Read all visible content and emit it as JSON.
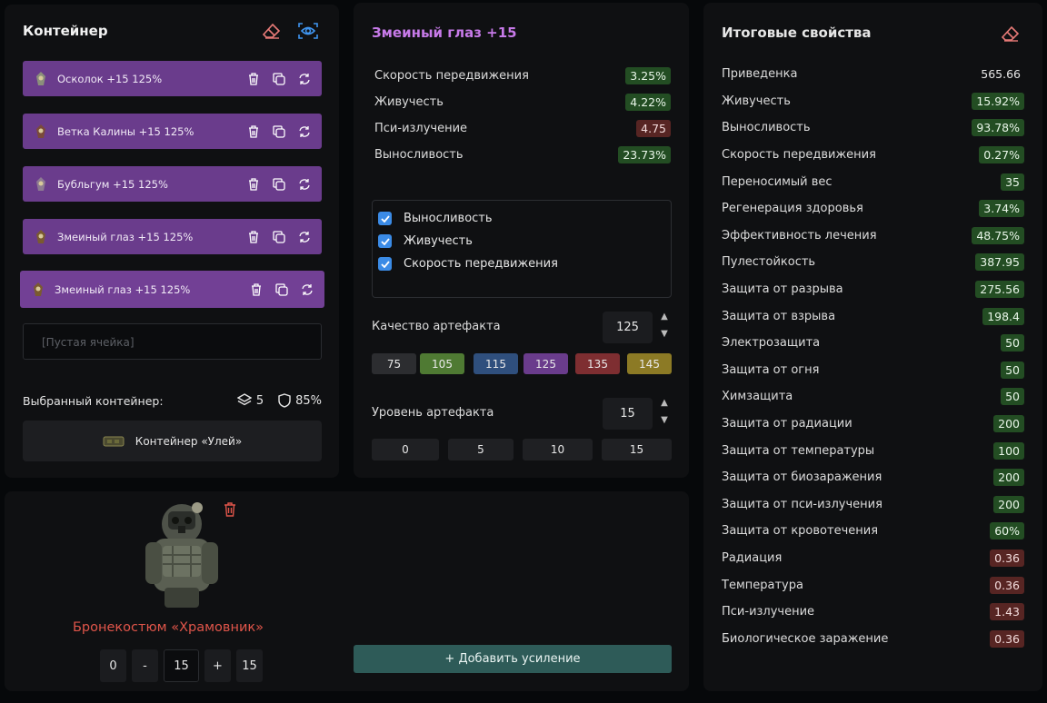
{
  "container_panel": {
    "title": "Контейнер",
    "slots": [
      {
        "label": "Осколок  +15  125%",
        "icon": "shard-artifact-icon"
      },
      {
        "label": "Ветка Калины  +15  125%",
        "icon": "branch-artifact-icon"
      },
      {
        "label": "Бубльгум  +15  125%",
        "icon": "bubblegum-artifact-icon"
      },
      {
        "label": "Змеиный глаз  +15  125%",
        "icon": "snake-eye-artifact-icon"
      },
      {
        "label": "Змеиный глаз  +15  125%",
        "icon": "snake-eye-artifact-icon",
        "selected": true
      }
    ],
    "empty_slot": "[Пустая ячейка]",
    "selected_container_label": "Выбранный контейнер:",
    "capacity": "5",
    "protection": "85%",
    "container_name": "Контейнер «Улей»"
  },
  "artifact_panel": {
    "title": "Змеиный глаз +15",
    "stats": [
      {
        "name": "Скорость передвижения",
        "value": "3.25%",
        "tone": "green"
      },
      {
        "name": "Живучесть",
        "value": "4.22%",
        "tone": "green"
      },
      {
        "name": "Пси-излучение",
        "value": "4.75",
        "tone": "red"
      },
      {
        "name": "Выносливость",
        "value": "23.73%",
        "tone": "green"
      }
    ],
    "checkboxes": [
      {
        "label": "Выносливость",
        "checked": true
      },
      {
        "label": "Живучесть",
        "checked": true
      },
      {
        "label": "Скорость передвижения",
        "checked": true
      }
    ],
    "quality_label": "Качество артефакта",
    "quality_value": "125",
    "quality_presets": [
      {
        "label": "75",
        "color": "#2c2d30"
      },
      {
        "label": "105",
        "color": "#4f7a33"
      },
      {
        "label": "115",
        "color": "#2f4f7d"
      },
      {
        "label": "125",
        "color": "#6a3c8c"
      },
      {
        "label": "135",
        "color": "#7e2e31"
      },
      {
        "label": "145",
        "color": "#8c7a25"
      }
    ],
    "level_label": "Уровень артефакта",
    "level_value": "15",
    "level_presets": [
      "0",
      "5",
      "10",
      "15"
    ]
  },
  "totals_panel": {
    "title": "Итоговые свойства",
    "rows": [
      {
        "name": "Приведенка",
        "value": "565.66",
        "tone": "plain"
      },
      {
        "name": "Живучесть",
        "value": "15.92%",
        "tone": "green"
      },
      {
        "name": "Выносливость",
        "value": "93.78%",
        "tone": "green"
      },
      {
        "name": "Скорость передвижения",
        "value": "0.27%",
        "tone": "green"
      },
      {
        "name": "Переносимый вес",
        "value": "35",
        "tone": "green"
      },
      {
        "name": "Регенерация здоровья",
        "value": "3.74%",
        "tone": "green"
      },
      {
        "name": "Эффективность лечения",
        "value": "48.75%",
        "tone": "green"
      },
      {
        "name": "Пулестойкость",
        "value": "387.95",
        "tone": "green"
      },
      {
        "name": "Защита от разрыва",
        "value": "275.56",
        "tone": "green"
      },
      {
        "name": "Защита от взрыва",
        "value": "198.4",
        "tone": "green"
      },
      {
        "name": "Электрозащита",
        "value": "50",
        "tone": "green"
      },
      {
        "name": "Защита от огня",
        "value": "50",
        "tone": "green"
      },
      {
        "name": "Химзащита",
        "value": "50",
        "tone": "green"
      },
      {
        "name": "Защита от радиации",
        "value": "200",
        "tone": "green"
      },
      {
        "name": "Защита от температуры",
        "value": "100",
        "tone": "green"
      },
      {
        "name": "Защита от биозаражения",
        "value": "200",
        "tone": "green"
      },
      {
        "name": "Защита от пси-излучения",
        "value": "200",
        "tone": "green"
      },
      {
        "name": "Защита от кровотечения",
        "value": "60%",
        "tone": "green"
      },
      {
        "name": "Радиация",
        "value": "0.36",
        "tone": "red"
      },
      {
        "name": "Температура",
        "value": "0.36",
        "tone": "red"
      },
      {
        "name": "Пси-излучение",
        "value": "1.43",
        "tone": "red"
      },
      {
        "name": "Биологическое заражение",
        "value": "0.36",
        "tone": "red"
      }
    ]
  },
  "armor_panel": {
    "name": "Бронекостюм «Храмовник»",
    "level_min": "0",
    "minus": "-",
    "level": "15",
    "plus": "+",
    "level_max": "15",
    "add_button": "+ Добавить усиление"
  }
}
